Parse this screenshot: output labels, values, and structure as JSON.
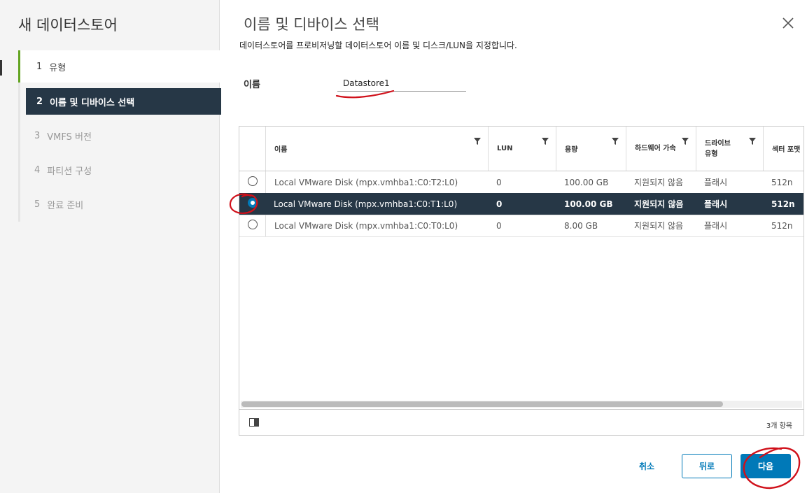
{
  "sidebar": {
    "title": "새 데이터스토어",
    "steps": [
      {
        "num": "1",
        "label": "유형"
      },
      {
        "num": "2",
        "label": "이름 및 디바이스 선택"
      },
      {
        "num": "3",
        "label": "VMFS 버전"
      },
      {
        "num": "4",
        "label": "파티션 구성"
      },
      {
        "num": "5",
        "label": "완료 준비"
      }
    ]
  },
  "main": {
    "title": "이름 및 디바이스 선택",
    "description": "데이터스토어를 프로비저닝할 데이터스토어 이름 및 디스크/LUN을 지정합니다.",
    "name_label": "이름",
    "name_value": "Datastore1"
  },
  "grid": {
    "columns": [
      "이름",
      "LUN",
      "용량",
      "하드웨어 가속",
      "드라이브 유형",
      "섹터 포맷"
    ],
    "rows": [
      {
        "name": "Local VMware Disk (mpx.vmhba1:C0:T2:L0)",
        "lun": "0",
        "capacity": "100.00 GB",
        "hw_accel": "지원되지 않음",
        "drive_type": "플래시",
        "sector": "512n",
        "selected": false
      },
      {
        "name": "Local VMware Disk (mpx.vmhba1:C0:T1:L0)",
        "lun": "0",
        "capacity": "100.00 GB",
        "hw_accel": "지원되지 않음",
        "drive_type": "플래시",
        "sector": "512n",
        "selected": true
      },
      {
        "name": "Local VMware Disk (mpx.vmhba1:C0:T0:L0)",
        "lun": "0",
        "capacity": "8.00 GB",
        "hw_accel": "지원되지 않음",
        "drive_type": "플래시",
        "sector": "512n",
        "selected": false
      }
    ],
    "count": "3개 항목"
  },
  "buttons": {
    "cancel": "취소",
    "back": "뒤로",
    "next": "다음"
  },
  "colors": {
    "selected_row": "#263746",
    "accent_blue": "#0079b8",
    "done_green": "#62a420",
    "annotation_red": "#d0101a"
  }
}
